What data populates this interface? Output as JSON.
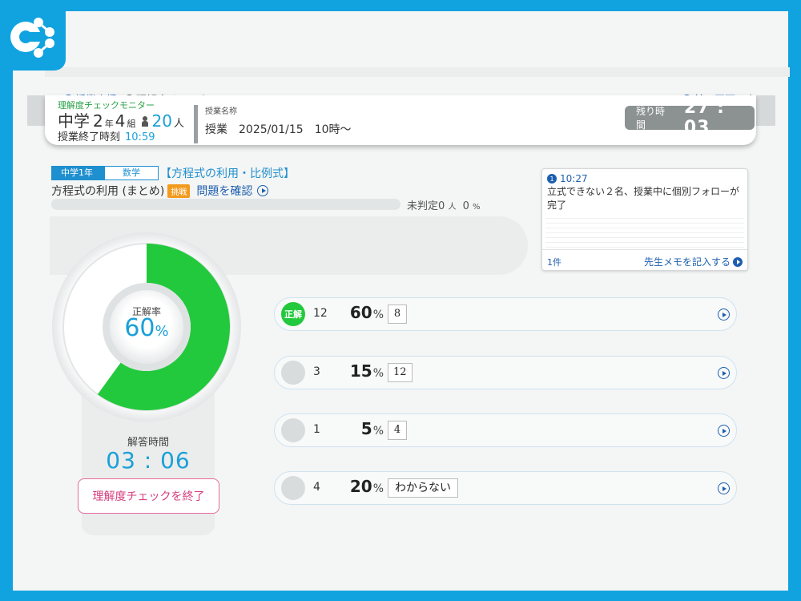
{
  "breadcrumb": {
    "items": [
      "授業支援",
      "理解度チェック"
    ],
    "back": "前の画面に戻る"
  },
  "header": {
    "monitor_label": "理解度チェックモニター",
    "school_level": "中学",
    "grade": "2",
    "grade_unit": "年",
    "class_no": "4",
    "class_unit": "組",
    "students": "20",
    "students_unit": "人",
    "end_time_label": "授業終了時刻",
    "end_time": "10:59",
    "lesson_label": "授業名称",
    "lesson_name": "授業　2025/01/15　10時～",
    "remaining_label": "残り時間",
    "remaining_time": "27 : 03"
  },
  "question": {
    "grade_tag": "中学1年",
    "subject_tag": "数学",
    "unit": "【方程式の利用・比例式】",
    "topic": "方程式の利用 (まとめ)",
    "challenge": "挑戦",
    "confirm": "問題を確認",
    "undecided_label": "未判定",
    "undecided_count": "0",
    "undecided_unit": "人",
    "undecided_pct": "0",
    "pct_unit": "%",
    "progress_fraction": 0
  },
  "correct_rate": {
    "label": "正解率",
    "value": 60,
    "display": "60",
    "unit": "%"
  },
  "answer_time": {
    "label": "解答時間",
    "value": "03 : 06"
  },
  "end_button": "理解度チェックを終了",
  "memo": {
    "num": "1",
    "time": "10:27",
    "text": "立式できない２名、授業中に個別フォローが完了",
    "count": "1件",
    "add": "先生メモを記入する"
  },
  "answers": [
    {
      "badge": "正解",
      "correct": true,
      "count": "12",
      "pct": "60",
      "answer": "8"
    },
    {
      "badge": "",
      "correct": false,
      "count": "3",
      "pct": "15",
      "answer": "12"
    },
    {
      "badge": "",
      "correct": false,
      "count": "1",
      "pct": "5",
      "answer": "4"
    },
    {
      "badge": "",
      "correct": false,
      "count": "4",
      "pct": "20",
      "answer": "わからない"
    }
  ],
  "colors": {
    "frame": "#11a3e0",
    "accent": "#1aa0d8",
    "correct": "#22c93c",
    "link": "#1d5fae",
    "danger": "#d63d7e"
  },
  "icons": [
    "app-logo-icon",
    "play-icon",
    "back-icon",
    "person-icon",
    "arrow-circle-icon"
  ]
}
